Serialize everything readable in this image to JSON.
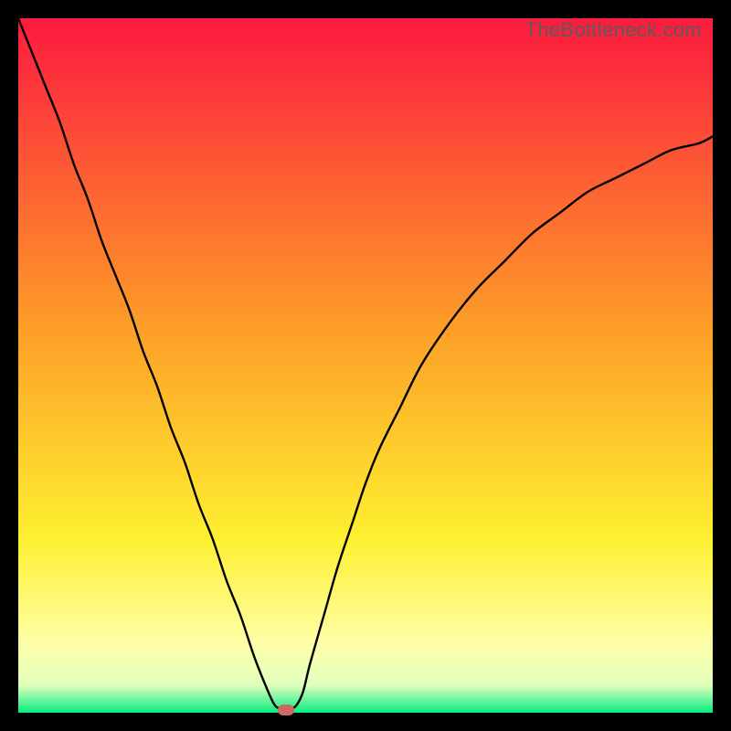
{
  "watermark": "TheBottleneck.com",
  "colors": {
    "gradient_top": "#fc1a3f",
    "gradient_mid1": "#fd9f28",
    "gradient_mid2": "#fef030",
    "gradient_mid3": "#feffa7",
    "gradient_mid4": "#e2ffbe",
    "gradient_bottom": "#07ec80",
    "curve": "#000000",
    "marker": "#cd6b62",
    "frame": "#000000"
  },
  "chart_data": {
    "type": "line",
    "title": "",
    "xlabel": "",
    "ylabel": "",
    "xlim": [
      0,
      100
    ],
    "ylim": [
      0,
      100
    ],
    "series": [
      {
        "name": "bottleneck-curve",
        "x": [
          0,
          2,
          4,
          6,
          8,
          10,
          12,
          14,
          16,
          18,
          20,
          22,
          24,
          26,
          28,
          30,
          32,
          34,
          36,
          37,
          38,
          39,
          40,
          41,
          42,
          44,
          46,
          48,
          50,
          52,
          55,
          58,
          62,
          66,
          70,
          74,
          78,
          82,
          86,
          90,
          94,
          98,
          100
        ],
        "y": [
          100,
          95,
          90,
          85,
          79,
          74,
          68,
          63,
          58,
          52,
          47,
          41,
          36,
          30,
          25,
          19,
          14,
          8,
          3,
          1,
          0.5,
          0.5,
          1,
          3,
          7,
          14,
          21,
          27,
          33,
          38,
          44,
          50,
          56,
          61,
          65,
          69,
          72,
          75,
          77,
          79,
          81,
          82,
          83
        ]
      }
    ],
    "marker": {
      "x": 38.5,
      "y": 0.4
    },
    "optimum_x": 38.5
  }
}
